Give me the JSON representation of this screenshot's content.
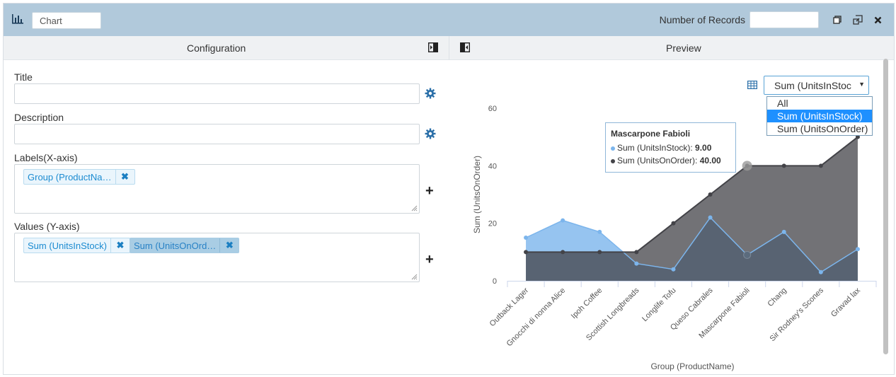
{
  "toolbar": {
    "chart_name": "Chart",
    "records_label": "Number of Records",
    "records_value": ""
  },
  "config": {
    "header": "Configuration",
    "title_label": "Title",
    "title_value": "",
    "description_label": "Description",
    "description_value": "",
    "labels_label": "Labels(X-axis)",
    "labels_tags": [
      "Group (ProductNa…"
    ],
    "values_label": "Values (Y-axis)",
    "values_tags": [
      "Sum (UnitsInStock)",
      "Sum (UnitsOnOrd…"
    ]
  },
  "preview": {
    "header": "Preview",
    "series_select": "Sum (UnitsInStoc",
    "series_options": [
      "All",
      "Sum (UnitsInStock)",
      "Sum (UnitsOnOrder)"
    ],
    "selected_option": "Sum (UnitsInStock)"
  },
  "tooltip": {
    "title": "Mascarpone Fabioli",
    "rows": [
      {
        "label": "Sum (UnitsInStock): ",
        "value": "9.00",
        "color": "#7cb5ec"
      },
      {
        "label": "Sum (UnitsOnOrder): ",
        "value": "40.00",
        "color": "#434348"
      }
    ]
  },
  "chart_data": {
    "type": "area",
    "xlabel": "Group (ProductName)",
    "ylabel": "Sum (UnitsOnOrder)",
    "ylim": [
      0,
      60
    ],
    "yticks": [
      0,
      20,
      40,
      60
    ],
    "categories": [
      "Outback Lager",
      "Gnocchi di nonna Alice",
      "Ipoh Coffee",
      "Scottish Longbreads",
      "Longlife Tofu",
      "Queso Cabrales",
      "Mascarpone Fabioli",
      "Chang",
      "Sir Rodney's Scones",
      "Gravad lax"
    ],
    "series": [
      {
        "name": "Sum (UnitsInStock)",
        "color": "#7cb5ec",
        "values": [
          15,
          21,
          17,
          6,
          4,
          22,
          9,
          17,
          3,
          11
        ]
      },
      {
        "name": "Sum (UnitsOnOrder)",
        "color": "#434348",
        "values": [
          10,
          10,
          10,
          10,
          20,
          30,
          40,
          40,
          40,
          50
        ]
      }
    ],
    "legend": "none",
    "grid": false
  }
}
